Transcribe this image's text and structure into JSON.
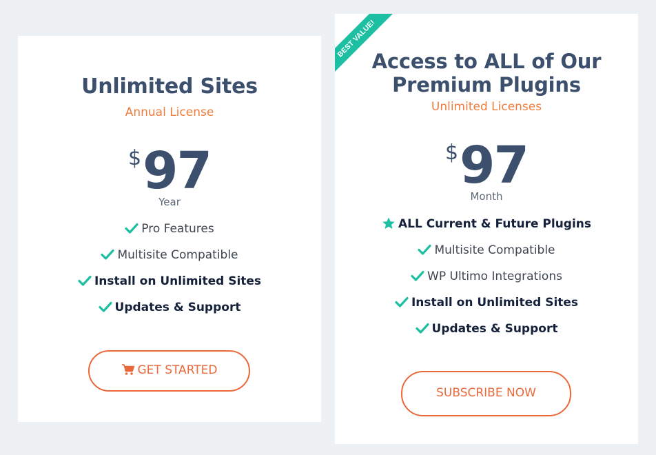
{
  "left_card": {
    "title": "Unlimited Sites",
    "subtitle": "Annual License",
    "currency": "$",
    "price": "97",
    "period": "Year",
    "features": [
      {
        "label": "Pro Features",
        "bold": false,
        "icon": "check-icon"
      },
      {
        "label": "Multisite Compatible",
        "bold": false,
        "icon": "check-icon"
      },
      {
        "label": "Install on Unlimited Sites",
        "bold": true,
        "icon": "check-icon"
      },
      {
        "label": "Updates & Support",
        "bold": true,
        "icon": "check-icon"
      }
    ],
    "button_label": "GET STARTED",
    "button_icon": "cart-icon"
  },
  "right_card": {
    "ribbon": "BEST VALUE!",
    "title_line1": "Access to ALL of Our",
    "title_line2": "Premium Plugins",
    "subtitle": "Unlimited Licenses",
    "currency": "$",
    "price": "97",
    "period": "Month",
    "features": [
      {
        "label": "ALL Current & Future Plugins",
        "bold": true,
        "icon": "star-icon"
      },
      {
        "label": "Multisite Compatible",
        "bold": false,
        "icon": "check-icon"
      },
      {
        "label": "WP Ultimo Integrations",
        "bold": false,
        "icon": "check-icon"
      },
      {
        "label": "Install on Unlimited Sites",
        "bold": true,
        "icon": "check-icon"
      },
      {
        "label": "Updates & Support",
        "bold": true,
        "icon": "check-icon"
      }
    ],
    "button_label": "SUBSCRIBE NOW"
  },
  "colors": {
    "background": "#eef1f3",
    "heading": "#3c4f6d",
    "accent_orange": "#f07c3b",
    "button_orange": "#e9693a",
    "check_teal": "#1dbfa3"
  }
}
